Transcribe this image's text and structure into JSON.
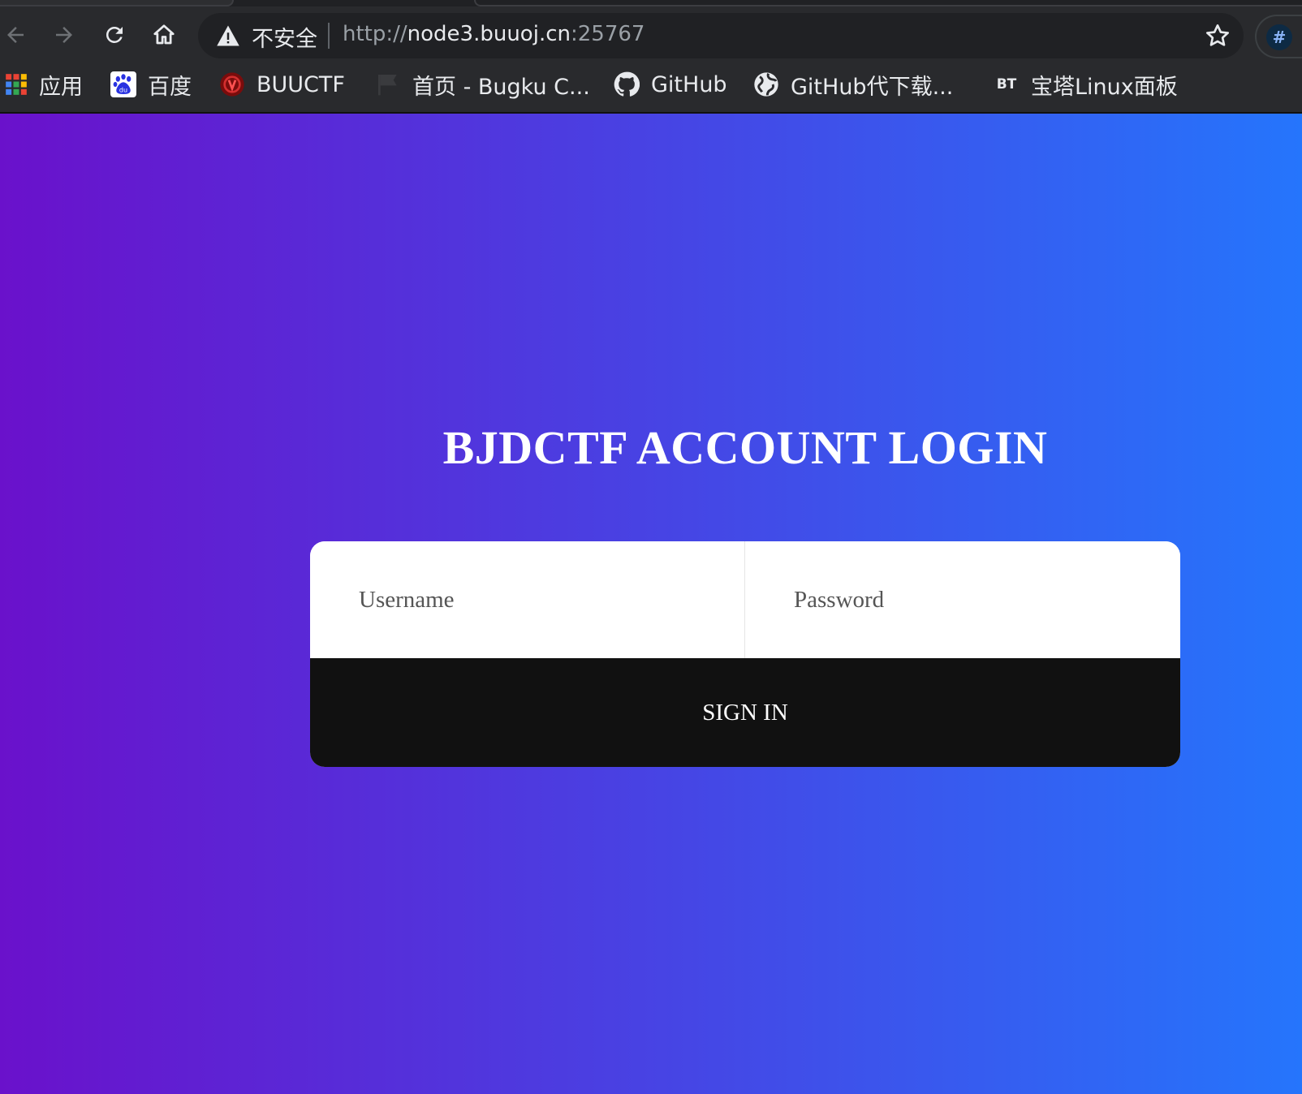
{
  "browser": {
    "address_bar": {
      "security_label": "不安全",
      "url_scheme": "http://",
      "url_host": "node3.buuoj.cn",
      "url_port": ":25767"
    },
    "extension_label": "#",
    "icons": {
      "back": "arrow-left-icon",
      "forward": "arrow-right-icon",
      "reload": "reload-icon",
      "home": "home-icon",
      "warning": "warning-triangle-icon",
      "bookmark_star": "star-icon"
    },
    "bookmarks": [
      {
        "label": "应用",
        "icon": "apps-grid-icon"
      },
      {
        "label": "百度",
        "icon": "baidu-icon"
      },
      {
        "label": "BUUCTF",
        "icon": "buuctf-icon"
      },
      {
        "label": "首页 - Bugku C...",
        "icon": "flag-icon"
      },
      {
        "label": "GitHub",
        "icon": "github-icon"
      },
      {
        "label": "GitHub代下载...",
        "icon": "globe-icon"
      },
      {
        "label": "宝塔Linux面板",
        "icon": "bt-icon",
        "icon_text": "BT"
      }
    ]
  },
  "page": {
    "title": "BJDCTF ACCOUNT LOGIN",
    "username": {
      "value": "",
      "placeholder": "Username"
    },
    "password": {
      "value": "",
      "placeholder": "Password"
    },
    "signin_label": "SIGN IN",
    "colors": {
      "gradient_start": "#6a11cb",
      "gradient_end": "#2575fc",
      "button_bg": "#111111",
      "card_bg": "#ffffff"
    }
  }
}
